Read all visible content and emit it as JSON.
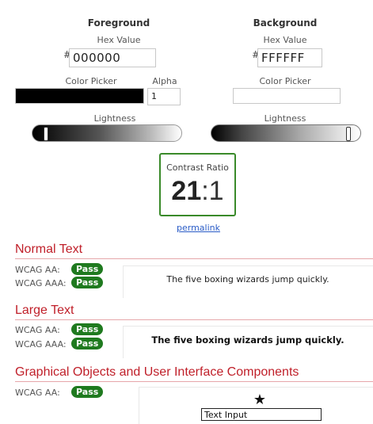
{
  "foreground": {
    "title": "Foreground",
    "hex_label": "Hex Value",
    "hash": "#",
    "hex_value": "000000",
    "picker_label": "Color Picker",
    "alpha_label": "Alpha",
    "alpha_value": "1",
    "lightness_label": "Lightness",
    "swatch_color": "#000000",
    "lightness_level": 0
  },
  "background": {
    "title": "Background",
    "hex_label": "Hex Value",
    "hash": "#",
    "hex_value": "FFFFFF",
    "picker_label": "Color Picker",
    "lightness_label": "Lightness",
    "swatch_color": "#FFFFFF",
    "lightness_level": 1
  },
  "contrast": {
    "label": "Contrast Ratio",
    "ratio_main": "21",
    "ratio_rest": ":1",
    "permalink": "permalink"
  },
  "sections": {
    "normal": {
      "title": "Normal Text",
      "aa_label": "WCAG AA:",
      "aa_result": "Pass",
      "aaa_label": "WCAG AAA:",
      "aaa_result": "Pass",
      "sample": "The five boxing wizards jump quickly."
    },
    "large": {
      "title": "Large Text",
      "aa_label": "WCAG AA:",
      "aa_result": "Pass",
      "aaa_label": "WCAG AAA:",
      "aaa_result": "Pass",
      "sample": "The five boxing wizards jump quickly."
    },
    "graphical": {
      "title": "Graphical Objects and User Interface Components",
      "aa_label": "WCAG AA:",
      "aa_result": "Pass",
      "star_icon": "star-icon",
      "input_value": "Text Input"
    }
  },
  "colors": {
    "accent_red": "#c0202a",
    "pass_green": "#1f7a1f",
    "ratio_border": "#3a8a2a",
    "link_blue": "#2a5cc7"
  }
}
